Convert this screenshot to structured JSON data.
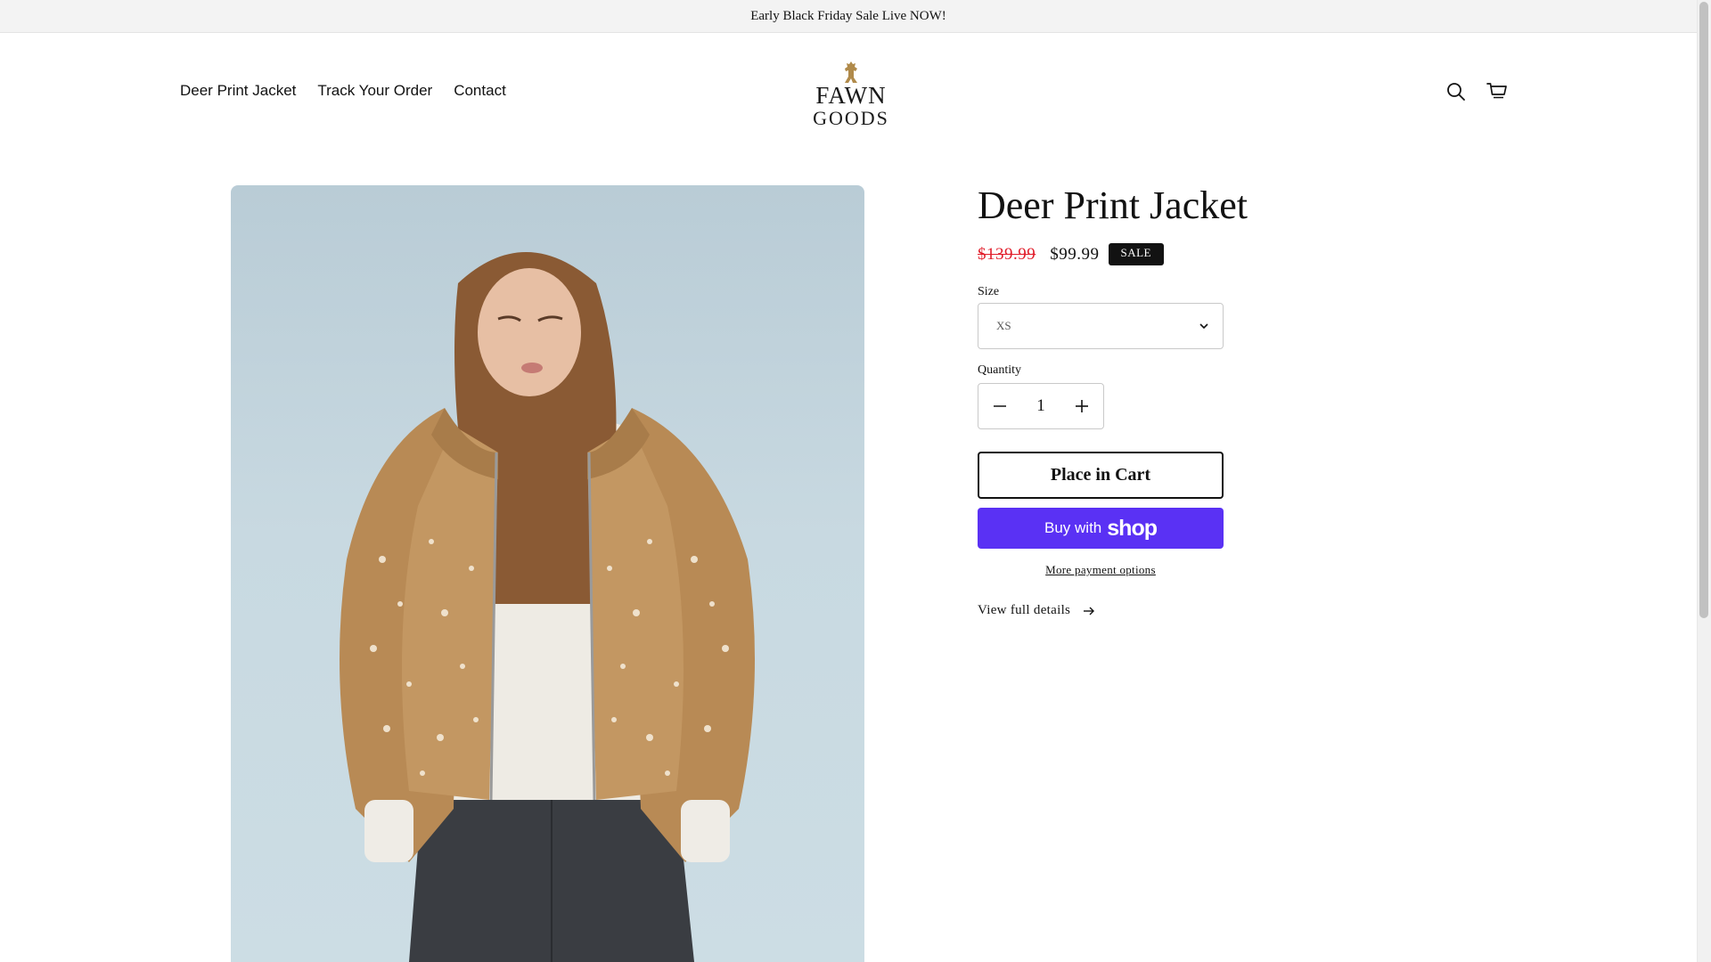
{
  "announcement": {
    "text": "Early Black Friday Sale Live NOW!"
  },
  "header": {
    "nav": [
      {
        "label": "Deer Print Jacket"
      },
      {
        "label": "Track Your Order"
      },
      {
        "label": "Contact"
      }
    ],
    "logo": {
      "line1": "FAWN",
      "line2": "GOODS",
      "accent_color": "#b08a4a"
    },
    "icons": [
      "search-icon",
      "cart-icon"
    ]
  },
  "product": {
    "title": "Deer Print Jacket",
    "compare_price": "$139.99",
    "price": "$99.99",
    "badge": "SALE",
    "size_label": "Size",
    "size_value": "XS",
    "quantity_label": "Quantity",
    "quantity_value": "1",
    "add_to_cart_label": "Place in Cart",
    "buy_with_label": "Buy with",
    "buy_with_brand": "shop",
    "more_payment_label": "More payment options",
    "view_details_label": "View full details"
  },
  "colors": {
    "compare_price": "#e11d2a",
    "shop_pay": "#5a31f4",
    "text": "#121212"
  }
}
